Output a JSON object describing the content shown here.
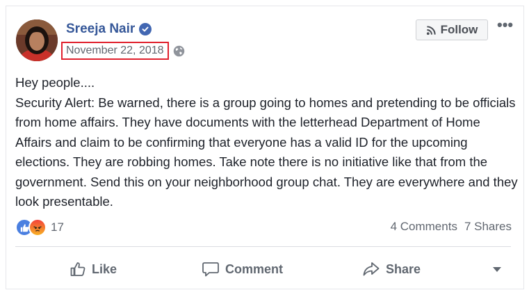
{
  "post": {
    "author": "Sreeja Nair",
    "date": "November 22, 2018",
    "paragraph_1": "Hey people....",
    "paragraph_2": "Security Alert: Be warned, there is a group going to homes and pretending to be officials from home affairs. They have documents with the letterhead Department of Home Affairs and claim to be confirming that everyone has a valid ID for the upcoming elections. They are robbing homes. Take note there is no initiative like that from the government. Send this on your neighborhood group chat. They are everywhere and they look presentable."
  },
  "header": {
    "follow_label": "Follow",
    "more_label": "•••"
  },
  "engagement": {
    "reaction_count": "17",
    "comments": "4 Comments",
    "shares": "7 Shares"
  },
  "actions": {
    "like": "Like",
    "comment": "Comment",
    "share": "Share"
  },
  "colors": {
    "author_link": "#365899",
    "highlight_border": "#e0202d",
    "like_reaction": "#4a7fe0"
  },
  "icons": [
    "verified-badge-icon",
    "globe-icon",
    "rss-icon",
    "thumbs-up-icon",
    "angry-reaction-icon",
    "comment-bubble-icon",
    "share-arrow-icon",
    "chevron-down-icon"
  ]
}
